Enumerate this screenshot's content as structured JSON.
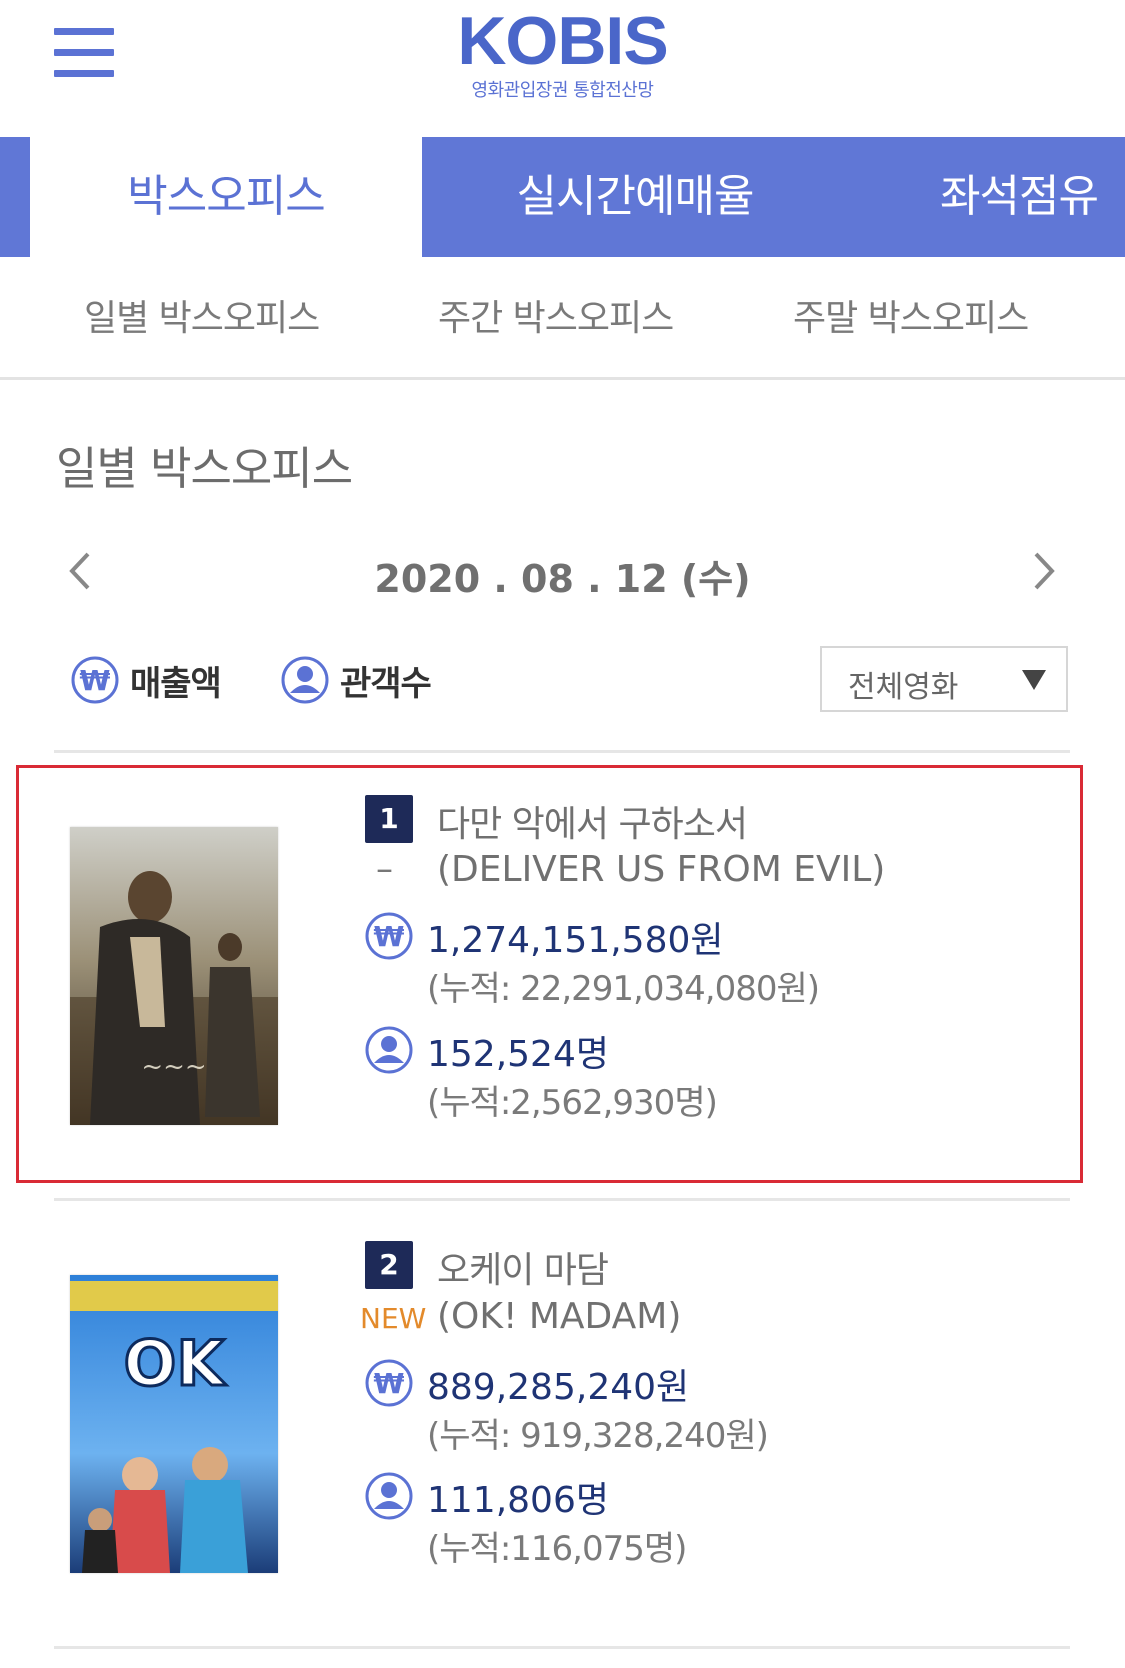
{
  "header": {
    "logo_main": "KOBIS",
    "logo_sub": "영화관입장권 통합전산망"
  },
  "colors": {
    "brand": "#5b72d4",
    "tab_bg": "#6077d6",
    "rank_bg": "#1e2a58",
    "value": "#1f3475",
    "highlight": "#d92a35",
    "new": "#e38a2b"
  },
  "main_tabs": [
    {
      "label": "박스오피스",
      "active": true
    },
    {
      "label": "실시간예매율",
      "active": false
    },
    {
      "label": "좌석점유",
      "active": false
    }
  ],
  "sub_tabs": [
    {
      "label": "일별 박스오피스"
    },
    {
      "label": "주간 박스오피스"
    },
    {
      "label": "주말 박스오피스"
    }
  ],
  "section_title": "일별 박스오피스",
  "date": {
    "value": "2020 . 08 . 12 (수)",
    "prev_icon": "chevron-left-icon",
    "next_icon": "chevron-right-icon"
  },
  "legend": {
    "sales_icon": "won-icon",
    "sales_label": "매출액",
    "audience_icon": "person-icon",
    "audience_label": "관객수"
  },
  "filter": {
    "selected": "전체영화",
    "icon": "caret-down-icon"
  },
  "movies": [
    {
      "rank": "1",
      "title_ko": "다만 악에서 구하소서",
      "title_en": "(DELIVER US FROM EVIL)",
      "status": "–",
      "sales": "1,274,151,580원",
      "sales_cum": "(누적: 22,291,034,080원)",
      "audience": "152,524명",
      "audience_cum": "(누적:2,562,930명)",
      "highlighted": true
    },
    {
      "rank": "2",
      "title_ko": "오케이 마담",
      "title_en": "(OK! MADAM)",
      "status": "NEW",
      "sales": "889,285,240원",
      "sales_cum": "(누적: 919,328,240원)",
      "audience": "111,806명",
      "audience_cum": "(누적:116,075명)",
      "highlighted": false
    }
  ]
}
